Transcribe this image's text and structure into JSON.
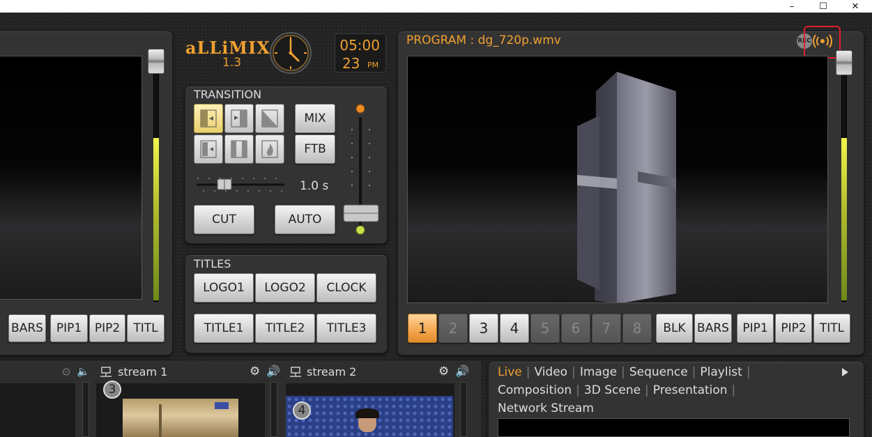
{
  "window": {
    "minimize_icon": "minimize-icon",
    "maximize_icon": "maximize-icon",
    "close_icon": "close-icon",
    "minimize_glyph": "–",
    "maximize_glyph": "☐",
    "close_glyph": "✕"
  },
  "logo": {
    "name": "aLLiMIX",
    "version": "1.3"
  },
  "clock": {
    "time": "05:00",
    "day": "23",
    "ampm": "PM"
  },
  "preview": {
    "buttons": [
      "BARS",
      "PIP1",
      "PIP2",
      "TITL"
    ]
  },
  "transition": {
    "title": "TRANSITION",
    "mix_label": "MIX",
    "ftb_label": "FTB",
    "duration": "1.0 s",
    "cut_label": "CUT",
    "auto_label": "AUTO",
    "icons": [
      "wipe-left-icon",
      "wipe-right-icon",
      "diagonal-icon",
      "slide-icon",
      "split-icon",
      "flame-icon"
    ]
  },
  "titles": {
    "title": "TITLES",
    "row1": [
      "LOGO1",
      "LOGO2",
      "CLOCK"
    ],
    "row2": [
      "TITLE1",
      "TITLE2",
      "TITLE3"
    ]
  },
  "program": {
    "title": "PROGRAM : dg_720p.wmv",
    "rec_label": "REC",
    "sources": [
      "1",
      "2",
      "3",
      "4",
      "5",
      "6",
      "7",
      "8"
    ],
    "active_source": "1",
    "buttons": [
      "BLK",
      "BARS",
      "PIP1",
      "PIP2",
      "TITL"
    ]
  },
  "streams": {
    "stream1": {
      "label": "stream 1",
      "badge": "3"
    },
    "stream2": {
      "label": "stream 2",
      "badge": "4"
    }
  },
  "source_tabs": {
    "row1": [
      "Live",
      "Video",
      "Image",
      "Sequence",
      "Playlist"
    ],
    "row2": [
      "Composition",
      "3D Scene",
      "Presentation"
    ],
    "row3": [
      "Network Stream"
    ],
    "active": "Live"
  },
  "colors": {
    "accent_orange": "#f0a030",
    "rec_highlight": "#e0202a"
  }
}
